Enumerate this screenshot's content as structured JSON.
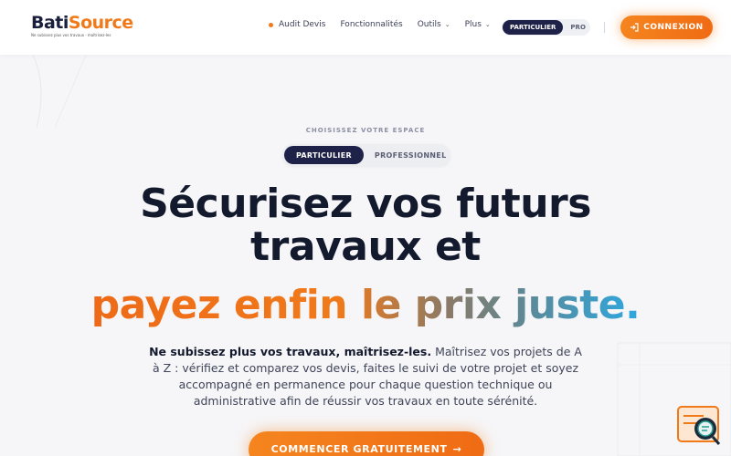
{
  "header": {
    "logo": {
      "word_bati": "Bati",
      "word_source": "Source",
      "tagline": "Ne subissez plus vos travaux · maîtrisez-les"
    },
    "nav": [
      {
        "label": "Audit Devis",
        "has_dot": true
      },
      {
        "label": "Fonctionnalités"
      },
      {
        "label": "Outils",
        "dropdown": true
      },
      {
        "label": "Plus",
        "dropdown": true
      }
    ],
    "mode_toggle": {
      "active": "PARTICULIER",
      "other": "PRO"
    },
    "login_label": "CONNEXION"
  },
  "hero": {
    "eyebrow": "CHOISISSEZ VOTRE ESPACE",
    "segment": {
      "active": "PARTICULIER",
      "other": "PROFESSIONNEL"
    },
    "title_line1": "Sécurisez vos futurs",
    "title_line2": "travaux et",
    "title_accent": "payez enfin le prix juste.",
    "subtitle_strong": "Ne subissez plus vos travaux, maîtrisez-les.",
    "subtitle_rest": " Maîtrisez vos projets de A à Z : vérifiez et comparez vos devis, faites le suivi de votre projet et soyez accompagné en permanence pour chaque question technique ou administrative afin de réussir vos travaux en toute sérénité.",
    "cta_label": "COMMENCER GRATUITEMENT"
  },
  "colors": {
    "accent": "#f07a1a",
    "navy": "#1e2148",
    "sky": "#2da8e0"
  },
  "icons": {
    "login": "login-arrow-icon",
    "cta": "arrow-right-icon",
    "chat": "chat-search-icon"
  }
}
